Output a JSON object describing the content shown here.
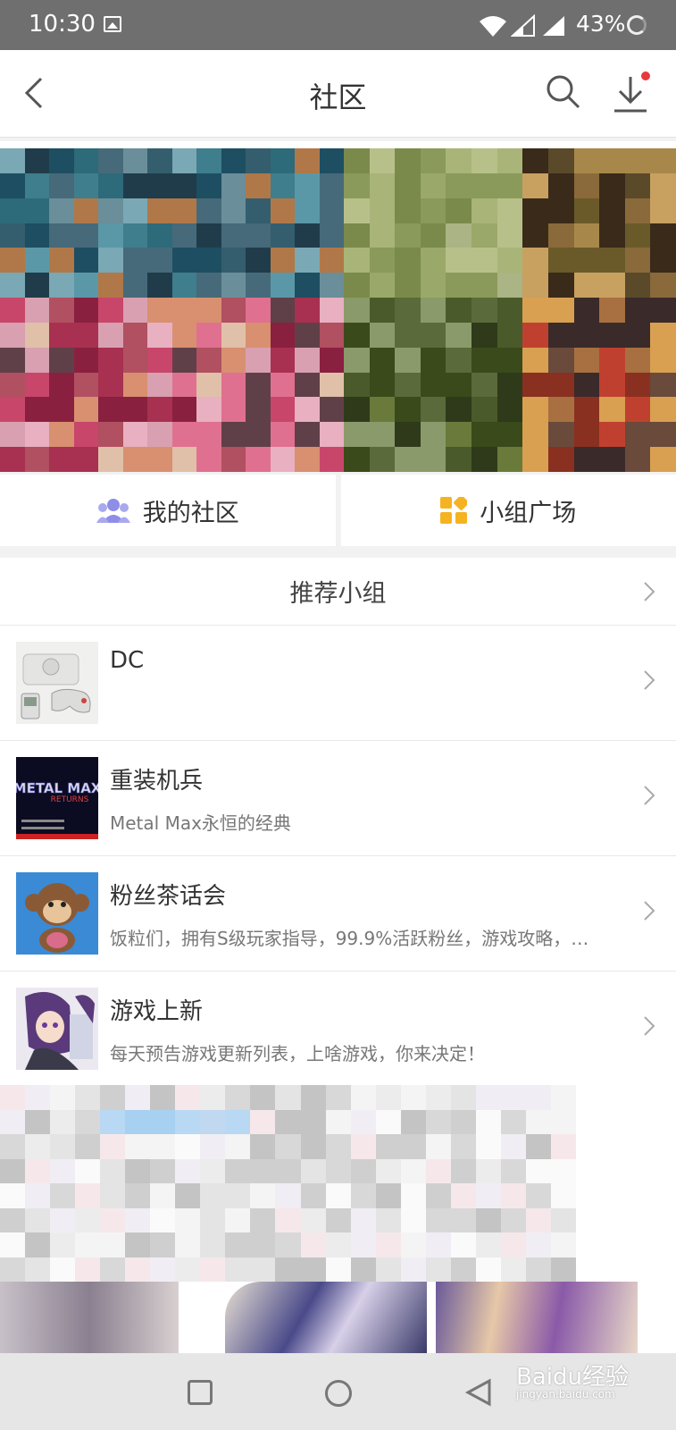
{
  "status_bar": {
    "time": "10:30",
    "battery": "43%"
  },
  "header": {
    "title": "社区"
  },
  "tabs": [
    {
      "label": "我的社区",
      "icon": "group-people-icon",
      "color": "#8e8ee8"
    },
    {
      "label": "小组广场",
      "icon": "grid-squares-icon",
      "color": "#f5b321"
    }
  ],
  "recommended": {
    "title": "推荐小组",
    "groups": [
      {
        "name": "DC",
        "desc": "",
        "thumb": "dreamcast-console-thumbnail"
      },
      {
        "name": "重装机兵",
        "desc": "Metal Max永恒的经典",
        "thumb": "metal-max-logo-thumbnail"
      },
      {
        "name": "粉丝茶话会",
        "desc": "饭粒们，拥有S级玩家指导，99.9%活跃粉丝，游戏攻略，…",
        "thumb": "monkey-mascot-thumbnail"
      },
      {
        "name": "游戏上新",
        "desc": "每天预告游戏更新列表，上啥游戏，你来决定！",
        "thumb": "anime-girl-thumbnail"
      }
    ]
  },
  "watermark": {
    "brand": "Baidu经验",
    "url": "jingyan.baidu.com"
  },
  "colors": {
    "accent_red": "#e8383d",
    "status_bar": "#6f6f6f"
  }
}
